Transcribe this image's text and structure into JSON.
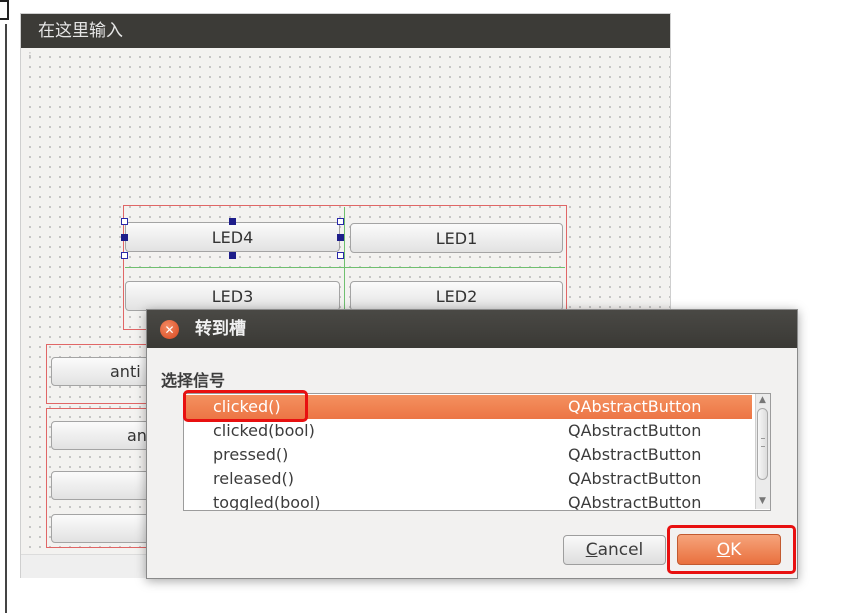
{
  "designer": {
    "window_title": "在这里输入",
    "buttons": {
      "led4": "LED4",
      "led1": "LED1",
      "led3": "LED3",
      "led2": "LED2",
      "anti_1": "anti",
      "anti_2": "an"
    }
  },
  "dialog": {
    "title": "转到槽",
    "section_label": "选择信号",
    "signals": [
      {
        "signal": "clicked()",
        "class": "QAbstractButton",
        "selected": true
      },
      {
        "signal": "clicked(bool)",
        "class": "QAbstractButton",
        "selected": false
      },
      {
        "signal": "pressed()",
        "class": "QAbstractButton",
        "selected": false
      },
      {
        "signal": "released()",
        "class": "QAbstractButton",
        "selected": false
      },
      {
        "signal": "toggled(bool)",
        "class": "QAbstractButton",
        "selected": false
      }
    ],
    "cancel_underline": "C",
    "cancel_rest": "ancel",
    "ok_underline": "O",
    "ok_rest": "K"
  },
  "colors": {
    "selection": "#ec7545",
    "highlight_box": "#e81010",
    "title_bar": "#3c3b37"
  },
  "icons": {
    "dialog_close": "close-icon",
    "scroll_up": "chevron-up-icon",
    "scroll_down": "chevron-down-icon"
  }
}
